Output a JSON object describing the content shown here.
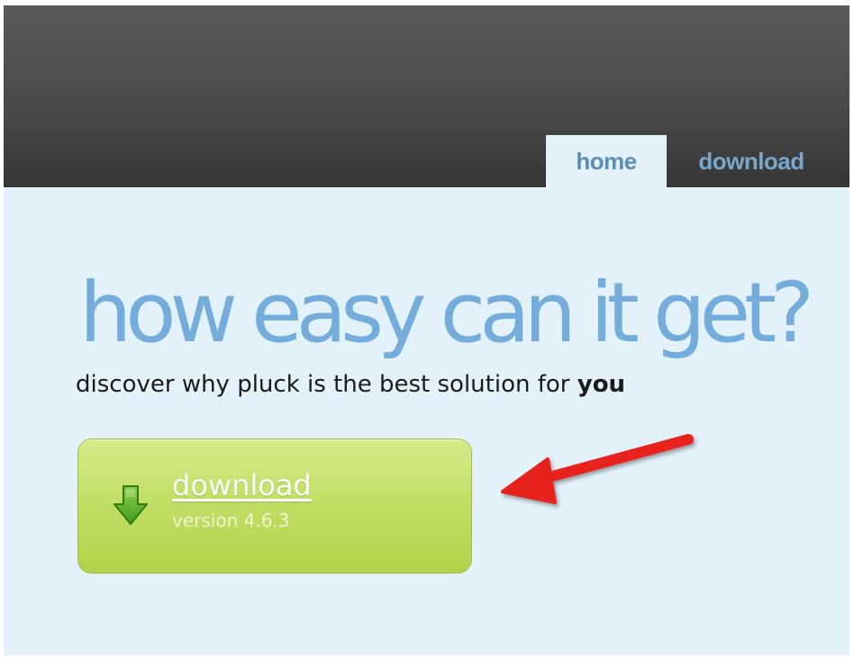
{
  "nav": {
    "tabs": [
      {
        "label": "home",
        "active": true
      },
      {
        "label": "download",
        "active": false
      }
    ]
  },
  "hero": {
    "headline": "how easy can it get?",
    "subline_prefix": "discover why pluck is the best solution for ",
    "subline_emphasis": "you"
  },
  "download_button": {
    "label": "download",
    "version": "version 4.6.3",
    "icon": "download-arrow-icon"
  },
  "annotation": {
    "icon": "red-arrow-icon",
    "color": "#e8201c"
  },
  "colors": {
    "topbar": "#4a4a4a",
    "page_background": "#e3f1fb",
    "headline": "#74addb",
    "button_green": "#c2df66"
  }
}
